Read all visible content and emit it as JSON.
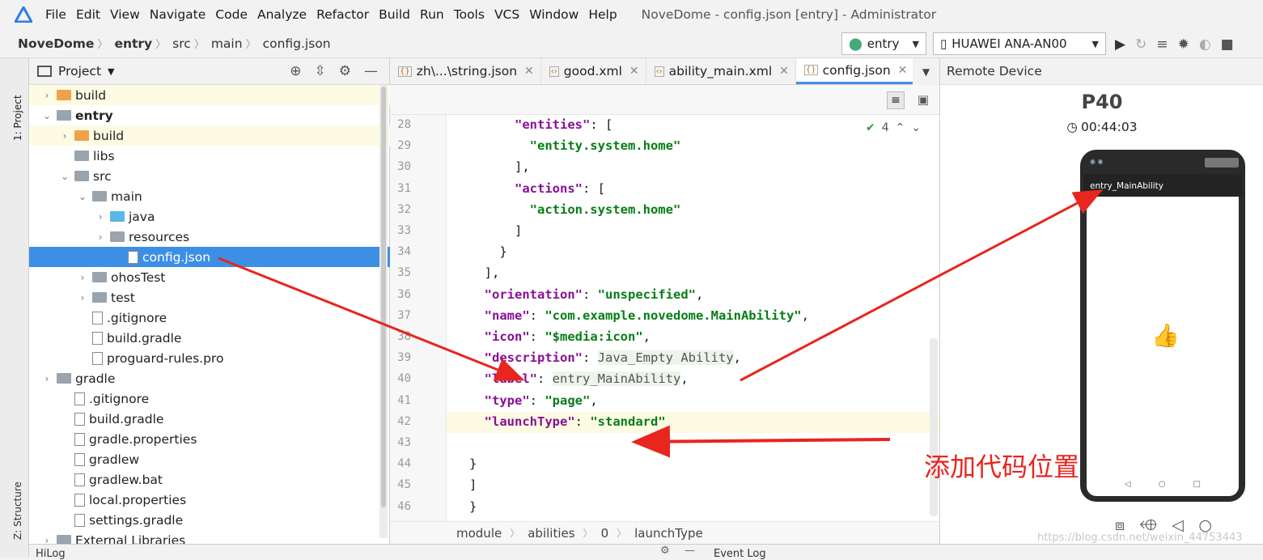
{
  "menubar": {
    "items": [
      "File",
      "Edit",
      "View",
      "Navigate",
      "Code",
      "Analyze",
      "Refactor",
      "Build",
      "Run",
      "Tools",
      "VCS",
      "Window",
      "Help"
    ],
    "window_title": "NoveDome - config.json [entry] - Administrator"
  },
  "breadcrumb": [
    "NoveDome",
    "entry",
    "src",
    "main",
    "config.json"
  ],
  "toolbar": {
    "module_combo": "entry",
    "device_combo": "HUAWEI ANA-AN00"
  },
  "left_stripe": {
    "project_tab": "1: Project",
    "structure_tab": "Z: Structure"
  },
  "project_panel": {
    "title": "Project",
    "tree": [
      {
        "label": "build",
        "depth": 1,
        "icon": "folder-orange",
        "arrow": "▶",
        "state": "hl"
      },
      {
        "label": "entry",
        "depth": 1,
        "icon": "module-folder",
        "arrow": "▼",
        "state": "",
        "bold": true
      },
      {
        "label": "build",
        "depth": 2,
        "icon": "folder-orange",
        "arrow": "▶",
        "state": "hl"
      },
      {
        "label": "libs",
        "depth": 2,
        "icon": "folder",
        "arrow": "",
        "state": ""
      },
      {
        "label": "src",
        "depth": 2,
        "icon": "folder",
        "arrow": "▼",
        "state": ""
      },
      {
        "label": "main",
        "depth": 3,
        "icon": "folder",
        "arrow": "▼",
        "state": ""
      },
      {
        "label": "java",
        "depth": 4,
        "icon": "folder-blue",
        "arrow": "▶",
        "state": ""
      },
      {
        "label": "resources",
        "depth": 4,
        "icon": "folder",
        "arrow": "▶",
        "state": ""
      },
      {
        "label": "config.json",
        "depth": 5,
        "icon": "json-file",
        "arrow": "",
        "state": "sel"
      },
      {
        "label": "ohosTest",
        "depth": 3,
        "icon": "folder",
        "arrow": "▶",
        "state": ""
      },
      {
        "label": "test",
        "depth": 3,
        "icon": "folder",
        "arrow": "▶",
        "state": ""
      },
      {
        "label": ".gitignore",
        "depth": 3,
        "icon": "file",
        "arrow": "",
        "state": ""
      },
      {
        "label": "build.gradle",
        "depth": 3,
        "icon": "gradle",
        "arrow": "",
        "state": ""
      },
      {
        "label": "proguard-rules.pro",
        "depth": 3,
        "icon": "file",
        "arrow": "",
        "state": ""
      },
      {
        "label": "gradle",
        "depth": 1,
        "icon": "folder",
        "arrow": "▶",
        "state": ""
      },
      {
        "label": ".gitignore",
        "depth": 2,
        "icon": "file",
        "arrow": "",
        "state": ""
      },
      {
        "label": "build.gradle",
        "depth": 2,
        "icon": "gradle",
        "arrow": "",
        "state": ""
      },
      {
        "label": "gradle.properties",
        "depth": 2,
        "icon": "props",
        "arrow": "",
        "state": ""
      },
      {
        "label": "gradlew",
        "depth": 2,
        "icon": "file",
        "arrow": "",
        "state": ""
      },
      {
        "label": "gradlew.bat",
        "depth": 2,
        "icon": "file",
        "arrow": "",
        "state": ""
      },
      {
        "label": "local.properties",
        "depth": 2,
        "icon": "props",
        "arrow": "",
        "state": ""
      },
      {
        "label": "settings.gradle",
        "depth": 2,
        "icon": "gradle",
        "arrow": "",
        "state": ""
      },
      {
        "label": "External Libraries",
        "depth": 1,
        "icon": "libs",
        "arrow": "▶",
        "state": ""
      }
    ]
  },
  "editor": {
    "tabs": [
      {
        "label": "zh\\...\\string.json",
        "active": false
      },
      {
        "label": "good.xml",
        "active": false
      },
      {
        "label": "ability_main.xml",
        "active": false
      },
      {
        "label": "config.json",
        "active": true
      }
    ],
    "inspection_count": "4",
    "lines": [
      {
        "n": "28",
        "indent": "      ",
        "html": [
          [
            "k",
            "\"entities\""
          ],
          [
            "p",
            ": ["
          ]
        ]
      },
      {
        "n": "29",
        "indent": "        ",
        "html": [
          [
            "s",
            "\"entity.system.home\""
          ]
        ]
      },
      {
        "n": "30",
        "indent": "      ",
        "html": [
          [
            "p",
            "],"
          ]
        ]
      },
      {
        "n": "31",
        "indent": "      ",
        "html": [
          [
            "k",
            "\"actions\""
          ],
          [
            "p",
            ": ["
          ]
        ]
      },
      {
        "n": "32",
        "indent": "        ",
        "html": [
          [
            "s",
            "\"action.system.home\""
          ]
        ]
      },
      {
        "n": "33",
        "indent": "      ",
        "html": [
          [
            "p",
            "]"
          ]
        ]
      },
      {
        "n": "34",
        "indent": "    ",
        "html": [
          [
            "p",
            "}"
          ]
        ]
      },
      {
        "n": "35",
        "indent": "  ",
        "html": [
          [
            "p",
            "],"
          ]
        ]
      },
      {
        "n": "36",
        "indent": "  ",
        "html": [
          [
            "k",
            "\"orientation\""
          ],
          [
            "p",
            ": "
          ],
          [
            "s",
            "\"unspecified\""
          ],
          [
            "p",
            ","
          ]
        ]
      },
      {
        "n": "37",
        "indent": "  ",
        "html": [
          [
            "k",
            "\"name\""
          ],
          [
            "p",
            ": "
          ],
          [
            "s",
            "\"com.example.novedome.MainAbility\""
          ],
          [
            "p",
            ","
          ]
        ]
      },
      {
        "n": "38",
        "indent": "  ",
        "html": [
          [
            "k",
            "\"icon\""
          ],
          [
            "p",
            ": "
          ],
          [
            "s",
            "\"$media:icon\""
          ],
          [
            "p",
            ","
          ]
        ]
      },
      {
        "n": "39",
        "indent": "  ",
        "html": [
          [
            "k",
            "\"description\""
          ],
          [
            "p",
            ": "
          ],
          [
            "u",
            "Java_Empty Ability"
          ],
          [
            "p",
            ","
          ]
        ]
      },
      {
        "n": "40",
        "indent": "  ",
        "html": [
          [
            "k",
            "\"label\""
          ],
          [
            "p",
            ": "
          ],
          [
            "u",
            "entry_MainAbility"
          ],
          [
            "p",
            ","
          ]
        ]
      },
      {
        "n": "41",
        "indent": "  ",
        "html": [
          [
            "k",
            "\"type\""
          ],
          [
            "p",
            ": "
          ],
          [
            "s",
            "\"page\""
          ],
          [
            "p",
            ","
          ]
        ]
      },
      {
        "n": "42",
        "indent": "  ",
        "html": [
          [
            "k",
            "\"launchType\""
          ],
          [
            "p",
            ": "
          ],
          [
            "s",
            "\"standard\""
          ]
        ]
      },
      {
        "n": "43",
        "indent": "",
        "html": []
      },
      {
        "n": "44",
        "indent": "",
        "html": [
          [
            "p",
            "}"
          ]
        ]
      },
      {
        "n": "45",
        "indent": "",
        "html": [
          [
            "p",
            "]"
          ]
        ]
      },
      {
        "n": "46",
        "indent": "",
        "html": [
          [
            "p",
            "}"
          ]
        ]
      }
    ],
    "status_path": [
      "module",
      "abilities",
      "0",
      "launchType"
    ]
  },
  "remote_device": {
    "title": "Remote Device",
    "device_name": "P40",
    "timer": "00:44:03",
    "app_title": "entry_MainAbility"
  },
  "annotation": {
    "text": "添加代码位置"
  },
  "bottom": {
    "left_tab": "HiLog",
    "right_tab": "Event Log"
  },
  "watermark": "https://blog.csdn.net/weixin_44753443",
  "colors": {
    "accent": "#3d8fe6",
    "keyword": "#871094",
    "string": "#067d17",
    "arrow": "#e8251f"
  }
}
